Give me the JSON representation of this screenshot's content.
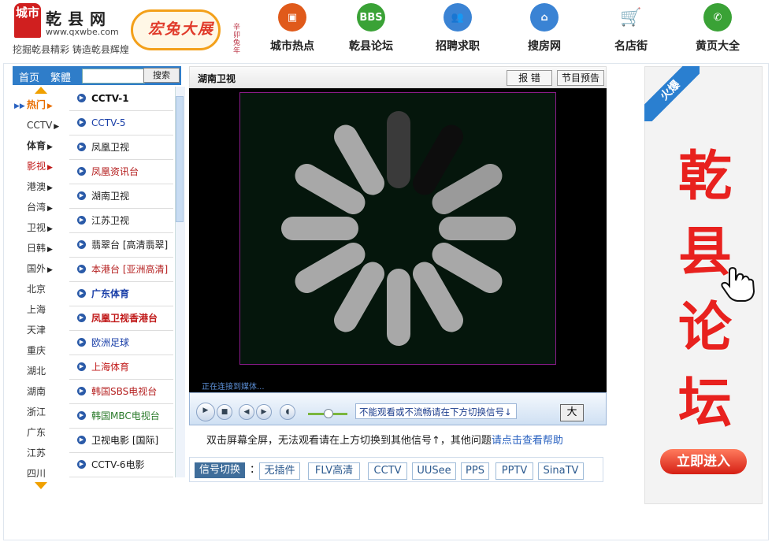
{
  "header": {
    "logo_city": "城市",
    "site_name": "乾县网",
    "site_url": "www.qxwbe.com",
    "slogan": "挖掘乾县精彩 铸造乾县辉煌",
    "banner_text": "宏兔大展",
    "banner_vertical": "辛卯兔年",
    "nav": [
      {
        "label": "城市热点",
        "icon": "tv-icon",
        "color": "#e05a1a",
        "glyph": "▣"
      },
      {
        "label": "乾县论坛",
        "icon": "bbs-icon",
        "color": "#3aa236",
        "glyph": "BBS"
      },
      {
        "label": "招聘求职",
        "icon": "people-icon",
        "color": "#3a83d4",
        "glyph": "👥"
      },
      {
        "label": "搜房网",
        "icon": "house-icon",
        "color": "#3a83d4",
        "glyph": "⌂"
      },
      {
        "label": "名店街",
        "icon": "cart-icon",
        "color": "#ffffff",
        "glyph": "🛒"
      },
      {
        "label": "黄页大全",
        "icon": "phone-icon",
        "color": "#3aa236",
        "glyph": "✆"
      }
    ]
  },
  "left_top": {
    "home": "首页",
    "traditional": "繁體",
    "search_value": "",
    "search_button": "搜索"
  },
  "categories": [
    {
      "label": "热门",
      "active": true,
      "arrow": "▶"
    },
    {
      "label": "CCTV",
      "arrow": "▶"
    },
    {
      "label": "体育",
      "arrow": "▶",
      "bold": true
    },
    {
      "label": "影视",
      "arrow": "▶",
      "red": true
    },
    {
      "label": "港澳",
      "arrow": "▶"
    },
    {
      "label": "台湾",
      "arrow": "▶"
    },
    {
      "label": "卫视",
      "arrow": "▶"
    },
    {
      "label": "日韩",
      "arrow": "▶"
    },
    {
      "label": "国外",
      "arrow": "▶"
    },
    {
      "label": "北京",
      "arrow": ""
    },
    {
      "label": "上海",
      "arrow": ""
    },
    {
      "label": "天津",
      "arrow": ""
    },
    {
      "label": "重庆",
      "arrow": ""
    },
    {
      "label": "湖北",
      "arrow": ""
    },
    {
      "label": "湖南",
      "arrow": ""
    },
    {
      "label": "浙江",
      "arrow": ""
    },
    {
      "label": "广东",
      "arrow": ""
    },
    {
      "label": "江苏",
      "arrow": ""
    },
    {
      "label": "四川",
      "arrow": ""
    }
  ],
  "channels": [
    {
      "label": "CCTV-1",
      "color": "#111111",
      "bold": true
    },
    {
      "label": "CCTV-5",
      "color": "#1a3fa8",
      "bold": false
    },
    {
      "label": "凤凰卫视",
      "color": "#222222",
      "bold": false
    },
    {
      "label": "凤凰资讯台",
      "color": "#b52020",
      "bold": false
    },
    {
      "label": "湖南卫视",
      "color": "#222222",
      "bold": false
    },
    {
      "label": "江苏卫视",
      "color": "#222222",
      "bold": false
    },
    {
      "label": "翡翠台 [高清翡翠]",
      "color": "#222222",
      "bold": false
    },
    {
      "label": "本港台 [亚洲高清]",
      "color": "#b52020",
      "bold": false
    },
    {
      "label": "广东体育",
      "color": "#1a3fa8",
      "bold": true
    },
    {
      "label": "凤凰卫视香港台",
      "color": "#c01818",
      "bold": true
    },
    {
      "label": "欧洲足球",
      "color": "#1a3fa8",
      "bold": false
    },
    {
      "label": "上海体育",
      "color": "#c01818",
      "bold": false
    },
    {
      "label": "韩国SBS电视台",
      "color": "#b52020",
      "bold": false
    },
    {
      "label": "韩国MBC电视台",
      "color": "#2a7a2a",
      "bold": false
    },
    {
      "label": "卫视电影 [国际]",
      "color": "#111111",
      "bold": false
    },
    {
      "label": "CCTV-6电影",
      "color": "#222222",
      "bold": false
    }
  ],
  "player": {
    "title": "湖南卫视",
    "report_button": "报 错",
    "schedule_button": "节目预告",
    "status": "正在连接到媒体...",
    "tip": "不能观看或不流畅请在下方切换信号↓",
    "big_button": "大",
    "help_text": "双击屏幕全屏，无法观看请在上方切换到其他信号↑，其他问题",
    "help_link": "请点击查看帮助"
  },
  "signal": {
    "label": "信号切换",
    "colon": "：",
    "options": [
      "无插件",
      "FLV高清",
      "CCTV",
      "UUSee",
      "PPS",
      "PPTV",
      "SinaTV"
    ]
  },
  "ad": {
    "ribbon": "火爆",
    "chars": [
      "乾",
      "县",
      "论",
      "坛"
    ],
    "enter": "立即进入"
  }
}
